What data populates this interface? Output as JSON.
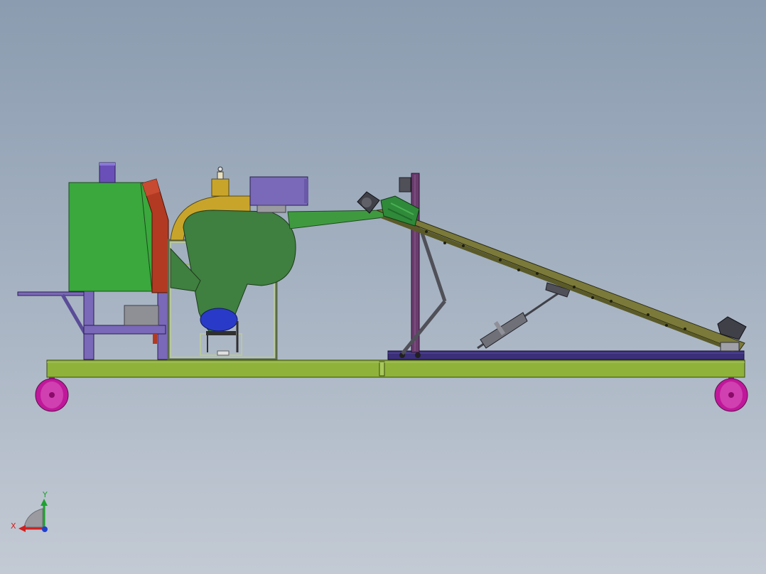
{
  "triad": {
    "x_label": "X",
    "y_label": "Y"
  },
  "colors": {
    "frame_lime": "#8fb23a",
    "hopper_green": "#3aa83d",
    "chute_red": "#b23a22",
    "stand_purple": "#7a68b8",
    "post_purple": "#6a3c6e",
    "wheel_magenta": "#c0189a",
    "fan_green": "#3f7f3f",
    "scroll_yellow": "#c8a52a",
    "motor_green": "#2f8a3a",
    "conveyor_olive": "#7b7a3a",
    "base_indigo": "#3a2f78"
  }
}
